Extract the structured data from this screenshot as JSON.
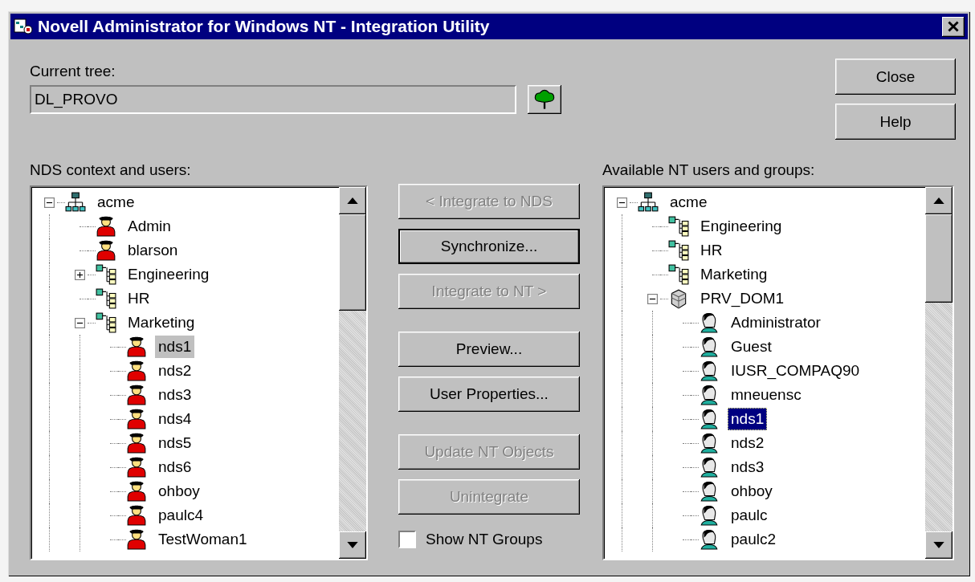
{
  "window": {
    "title": "Novell Administrator for Windows NT - Integration Utility"
  },
  "current_tree": {
    "label": "Current tree:",
    "value": "DL_PROVO"
  },
  "dialog_buttons": [
    "Close",
    "Help"
  ],
  "nds_panel": {
    "label": "NDS context and users:",
    "focused": false,
    "tree": [
      {
        "kind": "tree",
        "label": "acme",
        "selected": false,
        "expanded": true,
        "children": [
          {
            "kind": "user",
            "label": "Admin",
            "selected": false
          },
          {
            "kind": "user",
            "label": "blarson",
            "selected": false
          },
          {
            "kind": "group",
            "label": "Engineering",
            "selected": false,
            "expanded": false
          },
          {
            "kind": "group",
            "label": "HR",
            "selected": false
          },
          {
            "kind": "group",
            "label": "Marketing",
            "selected": false,
            "expanded": true,
            "children": [
              {
                "kind": "user",
                "label": "nds1",
                "selected": true
              },
              {
                "kind": "user",
                "label": "nds2",
                "selected": false
              },
              {
                "kind": "user",
                "label": "nds3",
                "selected": false
              },
              {
                "kind": "user",
                "label": "nds4",
                "selected": false
              },
              {
                "kind": "user",
                "label": "nds5",
                "selected": false
              },
              {
                "kind": "user",
                "label": "nds6",
                "selected": false
              },
              {
                "kind": "user",
                "label": "ohboy",
                "selected": false
              },
              {
                "kind": "user",
                "label": "paulc4",
                "selected": false
              },
              {
                "kind": "user",
                "label": "TestWoman1",
                "selected": false
              }
            ]
          }
        ]
      }
    ]
  },
  "action_groups": [
    [
      {
        "label": "< Integrate to NDS",
        "disabled": true,
        "default": false
      },
      {
        "label": "Synchronize...",
        "disabled": false,
        "default": true
      },
      {
        "label": "Integrate to NT >",
        "disabled": true,
        "default": false
      }
    ],
    [
      {
        "label": "Preview...",
        "disabled": false,
        "default": false
      },
      {
        "label": "User Properties...",
        "disabled": false,
        "default": false
      }
    ],
    [
      {
        "label": "Update NT Objects",
        "disabled": true,
        "default": false
      },
      {
        "label": "Unintegrate",
        "disabled": true,
        "default": false
      }
    ]
  ],
  "show_nt_groups": {
    "label": "Show NT Groups",
    "checked": false
  },
  "nt_panel": {
    "label": "Available NT users and groups:",
    "focused": true,
    "tree": [
      {
        "kind": "tree",
        "label": "acme",
        "selected": false,
        "expanded": true,
        "children": [
          {
            "kind": "group",
            "label": "Engineering",
            "selected": false
          },
          {
            "kind": "group",
            "label": "HR",
            "selected": false
          },
          {
            "kind": "group",
            "label": "Marketing",
            "selected": false
          },
          {
            "kind": "domain",
            "label": "PRV_DOM1",
            "selected": false,
            "expanded": true,
            "children": [
              {
                "kind": "ntuser",
                "label": "Administrator",
                "selected": false
              },
              {
                "kind": "ntuser",
                "label": "Guest",
                "selected": false
              },
              {
                "kind": "ntuser",
                "label": "IUSR_COMPAQ90",
                "selected": false
              },
              {
                "kind": "ntuser",
                "label": "mneuensc",
                "selected": false
              },
              {
                "kind": "ntuser",
                "label": "nds1",
                "selected": true
              },
              {
                "kind": "ntuser",
                "label": "nds2",
                "selected": false
              },
              {
                "kind": "ntuser",
                "label": "nds3",
                "selected": false
              },
              {
                "kind": "ntuser",
                "label": "ohboy",
                "selected": false
              },
              {
                "kind": "ntuser",
                "label": "paulc",
                "selected": false
              },
              {
                "kind": "ntuser",
                "label": "paulc2",
                "selected": false
              }
            ]
          }
        ]
      }
    ]
  }
}
